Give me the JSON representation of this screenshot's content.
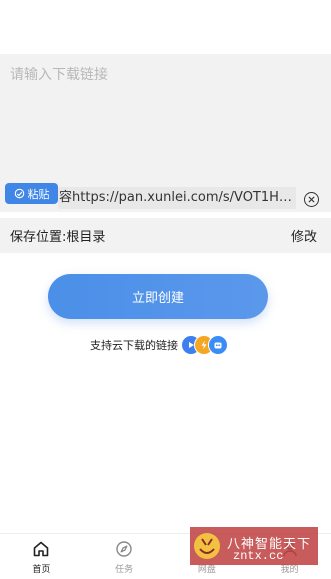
{
  "input": {
    "placeholder": "请输入下载链接",
    "paste_label": "粘贴",
    "clipboard_prefix": "容",
    "clipboard_link": "https://pan.xunlei.com/s/VOT1HM..."
  },
  "save_location": {
    "label": "保存位置:根目录",
    "action": "修改"
  },
  "create_button": "立即创建",
  "support_text": "支持云下载的链接",
  "nav": [
    {
      "label": "首页",
      "icon": "home-icon",
      "active": true
    },
    {
      "label": "任务",
      "icon": "compass-icon",
      "active": false
    },
    {
      "label": "网盘",
      "icon": "cloud-drive-icon",
      "active": false
    },
    {
      "label": "我的",
      "icon": "user-icon",
      "active": false
    }
  ],
  "watermark": {
    "line1": "八神智能天下",
    "line2": "zntx.cc"
  },
  "colors": {
    "accent": "#3f86e6",
    "input_bg": "#f2f2f2",
    "watermark": "#b92d2d"
  }
}
